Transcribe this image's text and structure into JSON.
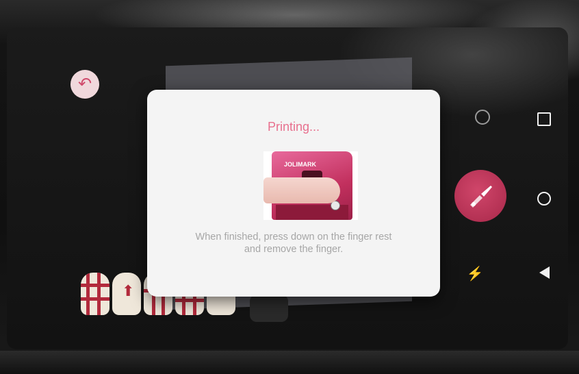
{
  "dialog": {
    "title": "Printing...",
    "message_line1": "When finished, press down on the finger rest",
    "message_line2": "and remove the finger.",
    "device_brand": "JOLIMARK"
  },
  "icons": {
    "undo": "↶",
    "magic": "⚡"
  },
  "colors": {
    "accent": "#e8708e",
    "brush_button": "#c13a5c",
    "nail_pattern": "#b22a3c"
  }
}
